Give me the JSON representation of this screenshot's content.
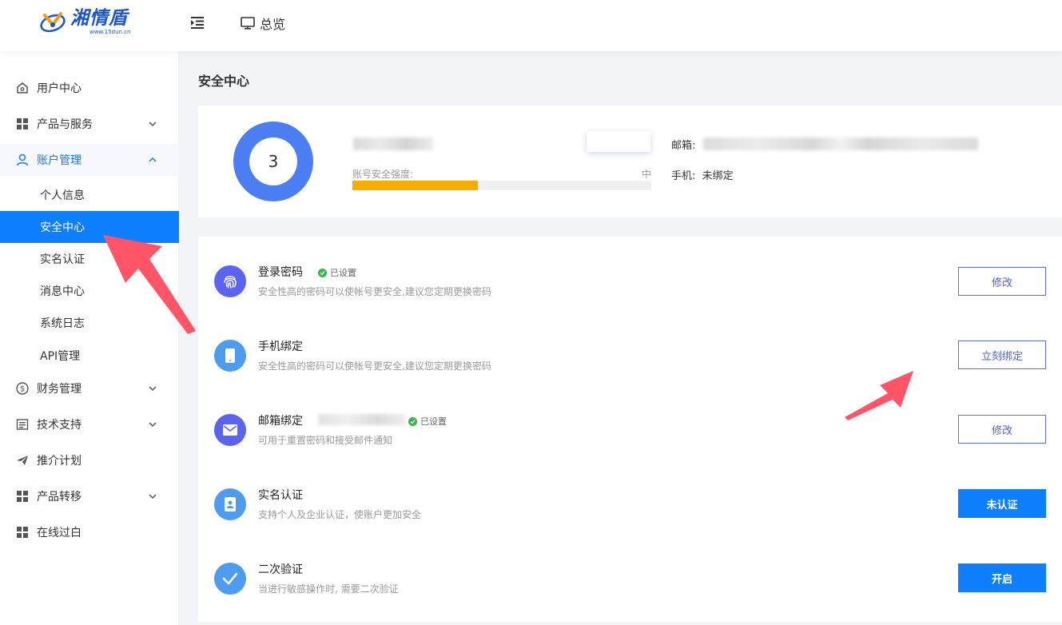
{
  "brand": {
    "name": "湘情盾",
    "domain": "www.15dun.cn"
  },
  "topbar": {
    "overview_label": "总览"
  },
  "sidebar": {
    "items": [
      {
        "label": "用户中心",
        "icon": "home-icon"
      },
      {
        "label": "产品与服务",
        "icon": "grid-icon",
        "expandable": true
      },
      {
        "label": "账户管理",
        "icon": "user-icon",
        "expandable": true,
        "open": true
      },
      {
        "label": "财务管理",
        "icon": "dollar-icon",
        "expandable": true
      },
      {
        "label": "技术支持",
        "icon": "document-icon",
        "expandable": true
      },
      {
        "label": "推介计划",
        "icon": "paper-plane-icon"
      },
      {
        "label": "产品转移",
        "icon": "grid-icon",
        "expandable": true
      },
      {
        "label": "在线过白",
        "icon": "grid-icon"
      }
    ],
    "sub_items": [
      "个人信息",
      "安全中心",
      "实名认证",
      "消息中心",
      "系统日志",
      "API管理"
    ],
    "active_sub": "安全中心"
  },
  "page": {
    "title": "安全中心"
  },
  "summary": {
    "score": "3",
    "strength_label": "账号安全强度:",
    "strength_value": "中",
    "strength_fraction": 0.42,
    "email_label": "邮箱:",
    "phone_label": "手机:",
    "phone_value": "未绑定"
  },
  "security_items": [
    {
      "title": "登录密码",
      "status": "已设置",
      "desc": "安全性高的密码可以使帐号更安全,建议您定期更换密码",
      "button": "修改",
      "style": "outline",
      "icon": "fingerprint-icon",
      "color": "#5b64f0"
    },
    {
      "title": "手机绑定",
      "status": "",
      "desc": "安全性高的密码可以使帐号更安全,建议您定期更换密码",
      "button": "立刻绑定",
      "style": "outline",
      "icon": "phone-icon",
      "color": "#4e9cf0"
    },
    {
      "title": "邮箱绑定",
      "status": "已设置",
      "desc": "可用于重置密码和接受邮件通知",
      "button": "修改",
      "style": "outline",
      "icon": "mail-icon",
      "color": "#5b64f0"
    },
    {
      "title": "实名认证",
      "status": "",
      "desc": "支持个人及企业认证，使账户更加安全",
      "button": "未认证",
      "style": "solid",
      "icon": "id-card-icon",
      "color": "#4e9cf0"
    },
    {
      "title": "二次验证",
      "status": "",
      "desc": "当进行敏感操作时, 需要二次验证",
      "button": "开启",
      "style": "solid",
      "icon": "check-icon",
      "color": "#4e9cf0"
    }
  ],
  "colors": {
    "accent": "#0d7fff",
    "strength_bar": "#f8ac00",
    "ring": "#4c7ef3",
    "annotation_arrow": "#ff5566"
  }
}
